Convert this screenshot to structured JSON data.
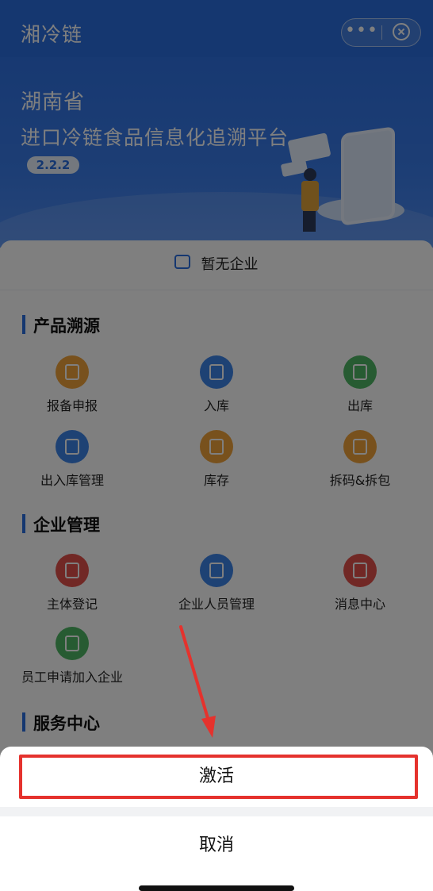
{
  "header": {
    "title": "湘冷链",
    "menu_icon": "more-dots-icon",
    "close_icon": "close-circle-icon",
    "menu_glyph": "•••"
  },
  "banner": {
    "province": "湖南省",
    "platform_title": "进口冷链食品信息化追溯平台",
    "version": "2.2.2"
  },
  "company": {
    "status_text": "暂无企业",
    "icon": "store-icon"
  },
  "sections": [
    {
      "title": "产品溯源",
      "items": [
        {
          "label": "报备申报",
          "icon": "report-icon",
          "color": "#f1a33a"
        },
        {
          "label": "入库",
          "icon": "inbound-icon",
          "color": "#3d84e8"
        },
        {
          "label": "出库",
          "icon": "outbound-icon",
          "color": "#4fb764"
        },
        {
          "label": "出入库管理",
          "icon": "inventory-manage-icon",
          "color": "#3d84e8"
        },
        {
          "label": "库存",
          "icon": "stock-icon",
          "color": "#f1a33a"
        },
        {
          "label": "拆码&拆包",
          "icon": "unpack-icon",
          "color": "#f1a33a"
        }
      ]
    },
    {
      "title": "企业管理",
      "items": [
        {
          "label": "主体登记",
          "icon": "registration-icon",
          "color": "#e2514a"
        },
        {
          "label": "企业人员管理",
          "icon": "staff-manage-icon",
          "color": "#3d84e8"
        },
        {
          "label": "消息中心",
          "icon": "message-icon",
          "color": "#e2514a"
        },
        {
          "label": "员工申请加入企业",
          "icon": "join-company-icon",
          "color": "#4fb764"
        }
      ]
    },
    {
      "title": "服务中心",
      "items": []
    }
  ],
  "action_sheet": {
    "activate_label": "激活",
    "cancel_label": "取消"
  },
  "colors": {
    "primary": "#2b6fe0",
    "highlight": "#e5322d"
  }
}
